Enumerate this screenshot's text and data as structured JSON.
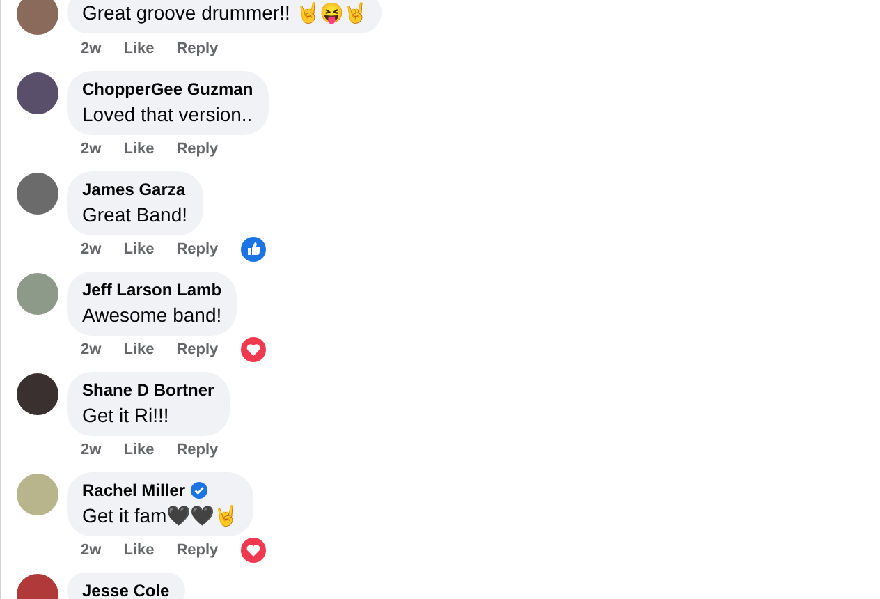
{
  "comments": [
    {
      "text": "Great groove drummer!! 🤘😝🤘",
      "time": "2w",
      "like": "Like",
      "reply": "Reply"
    },
    {
      "author": "ChopperGee Guzman",
      "text": "Loved that version..",
      "time": "2w",
      "like": "Like",
      "reply": "Reply",
      "verified": false
    },
    {
      "author": "James Garza",
      "text": "Great Band!",
      "time": "2w",
      "like": "Like",
      "reply": "Reply",
      "verified": false,
      "reaction": {
        "kind": "like"
      }
    },
    {
      "author": "Jeff Larson Lamb",
      "text": "Awesome band!",
      "time": "2w",
      "like": "Like",
      "reply": "Reply",
      "verified": false,
      "reaction": {
        "kind": "love"
      }
    },
    {
      "author": "Shane D Bortner",
      "text": "Get it Ri!!!",
      "time": "2w",
      "like": "Like",
      "reply": "Reply",
      "verified": false
    },
    {
      "author": "Rachel Miller",
      "text": "Get it fam🖤🖤🤘",
      "time": "2w",
      "like": "Like",
      "reply": "Reply",
      "verified": true,
      "reaction": {
        "kind": "love"
      }
    },
    {
      "author": "Jesse Cole",
      "verified": false
    }
  ]
}
